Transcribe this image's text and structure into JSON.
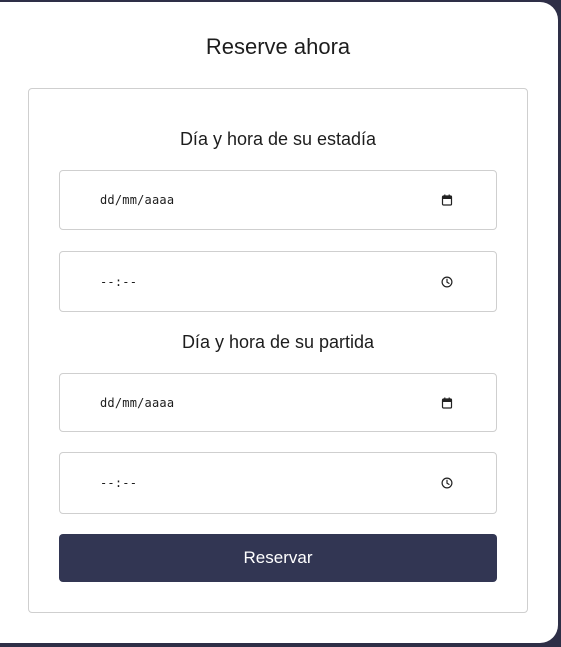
{
  "title": "Reserve ahora",
  "arrival": {
    "heading": "Día y hora de su estadía",
    "date_value": "dd/mm/aaaa",
    "time_value": "--:--"
  },
  "departure": {
    "heading": "Día y hora de su partida",
    "date_value": "dd/mm/aaaa",
    "time_value": "--:--"
  },
  "submit_label": "Reservar",
  "icons": {
    "date": "calendar-icon",
    "time": "clock-icon"
  },
  "colors": {
    "background": "#2e2f47",
    "button": "#323653",
    "button_text": "#ffffff"
  }
}
